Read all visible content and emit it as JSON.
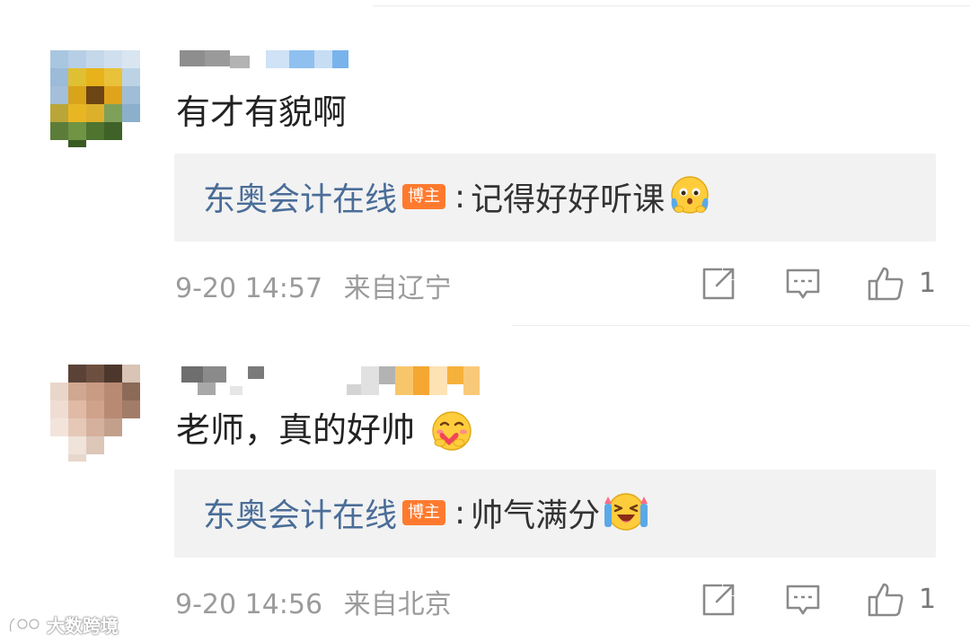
{
  "comments": [
    {
      "text": "有才有貌啊",
      "reply": {
        "author": "东奥会计在线",
        "badge": "博主",
        "colon": ":",
        "text": "记得好好听课"
      },
      "time": "9-20 14:57",
      "location": "来自辽宁",
      "likes": "1"
    },
    {
      "text": "老师，真的好帅",
      "reply": {
        "author": "东奥会计在线",
        "badge": "博主",
        "colon": ":",
        "text": "帅气满分"
      },
      "time": "9-20 14:56",
      "location": "来自北京",
      "likes": "1"
    }
  ],
  "watermark": {
    "text": "大数跨境"
  },
  "colors": {
    "author_link": "#4a6d98",
    "badge": "#ff7a2e",
    "reply_bg": "#f2f2f2",
    "meta_text": "#9b9b9b"
  },
  "icons": [
    "share-icon",
    "reply-icon",
    "like-icon",
    "emoji-icon",
    "watermark-logo-icon"
  ]
}
